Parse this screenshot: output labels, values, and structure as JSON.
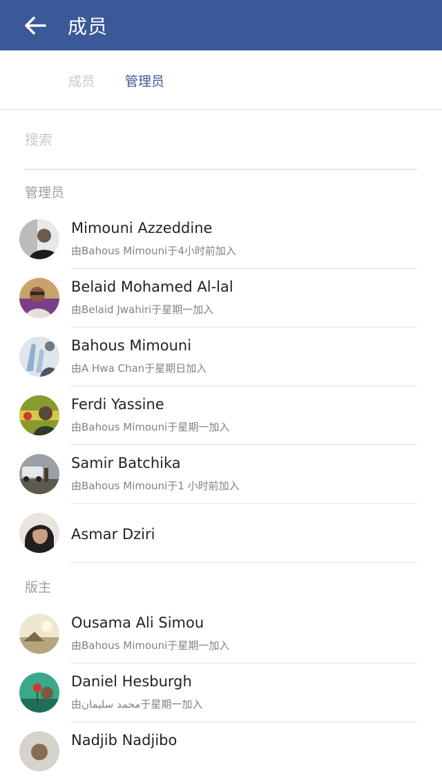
{
  "appbar": {
    "title": "成员",
    "back_icon": "arrow-left-icon",
    "color": "#3b5998"
  },
  "tabs": [
    {
      "label": "成员",
      "active": false
    },
    {
      "label": "管理员",
      "active": true
    }
  ],
  "search": {
    "placeholder": "搜索",
    "value": ""
  },
  "sections": [
    {
      "header": "管理员",
      "members": [
        {
          "name": "Mimouni Azzeddine",
          "subtitle": "由Bahous Mimouni于4小时前加入",
          "avatar": "avatar-photo"
        },
        {
          "name": "Belaid Mohamed Al-lal",
          "subtitle": "由Belaid Jwahiri于星期一加入",
          "avatar": "avatar-photo"
        },
        {
          "name": "Bahous Mimouni",
          "subtitle": "由A Hwa Chan于星期日加入",
          "avatar": "avatar-photo"
        },
        {
          "name": "Ferdi Yassine",
          "subtitle": "由Bahous Mimouni于星期一加入",
          "avatar": "avatar-photo"
        },
        {
          "name": "Samir Batchika",
          "subtitle": "由Bahous Mimouni于1 小时前加入",
          "avatar": "avatar-photo"
        },
        {
          "name": "Asmar Dziri",
          "subtitle": "",
          "avatar": "avatar-photo"
        }
      ]
    },
    {
      "header": "版主",
      "members": [
        {
          "name": "Ousama Ali Simou",
          "subtitle": "由Bahous Mimouni于星期一加入",
          "avatar": "avatar-photo"
        },
        {
          "name": "Daniel Hesburgh",
          "subtitle": "由محمد سليمان于星期一加入",
          "avatar": "avatar-photo"
        },
        {
          "name": "Nadjib Nadjibo",
          "subtitle": "",
          "avatar": "avatar-photo"
        }
      ]
    }
  ]
}
